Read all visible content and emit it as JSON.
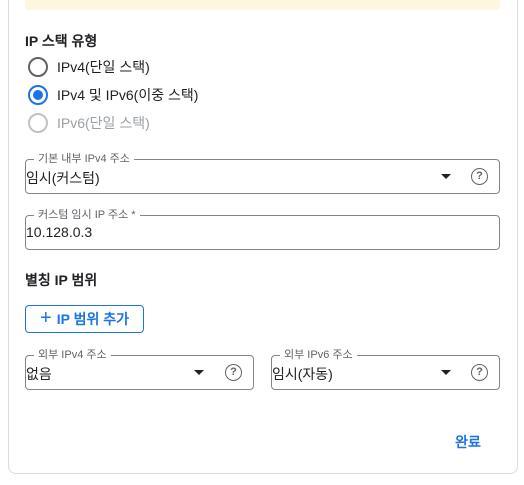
{
  "ip_stack": {
    "title": "IP 스택 유형",
    "options": [
      {
        "label": "IPv4(단일 스택)",
        "checked": false,
        "disabled": false
      },
      {
        "label": "IPv4 및 IPv6(이중 스택)",
        "checked": true,
        "disabled": false
      },
      {
        "label": "IPv6(단일 스택)",
        "checked": false,
        "disabled": true
      }
    ]
  },
  "primary_ipv4": {
    "label": "기본 내부 IPv4 주소",
    "value": "임시(커스텀)",
    "help_icon": "?"
  },
  "custom_ephemeral_ip": {
    "label": "커스텀 임시 IP 주소 *",
    "value": "10.128.0.3"
  },
  "alias_ip": {
    "title": "별칭 IP 범위",
    "add_button": "IP 범위 추가",
    "add_icon": "+"
  },
  "external_ipv4": {
    "label": "외부 IPv4 주소",
    "value": "없음",
    "help_icon": "?"
  },
  "external_ipv6": {
    "label": "외부 IPv6 주소",
    "value": "임시(자동)",
    "help_icon": "?"
  },
  "footer": {
    "done_button": "완료"
  },
  "colors": {
    "accent": "#1a73e8",
    "banner": "#fef7e0",
    "border": "#80868b"
  }
}
